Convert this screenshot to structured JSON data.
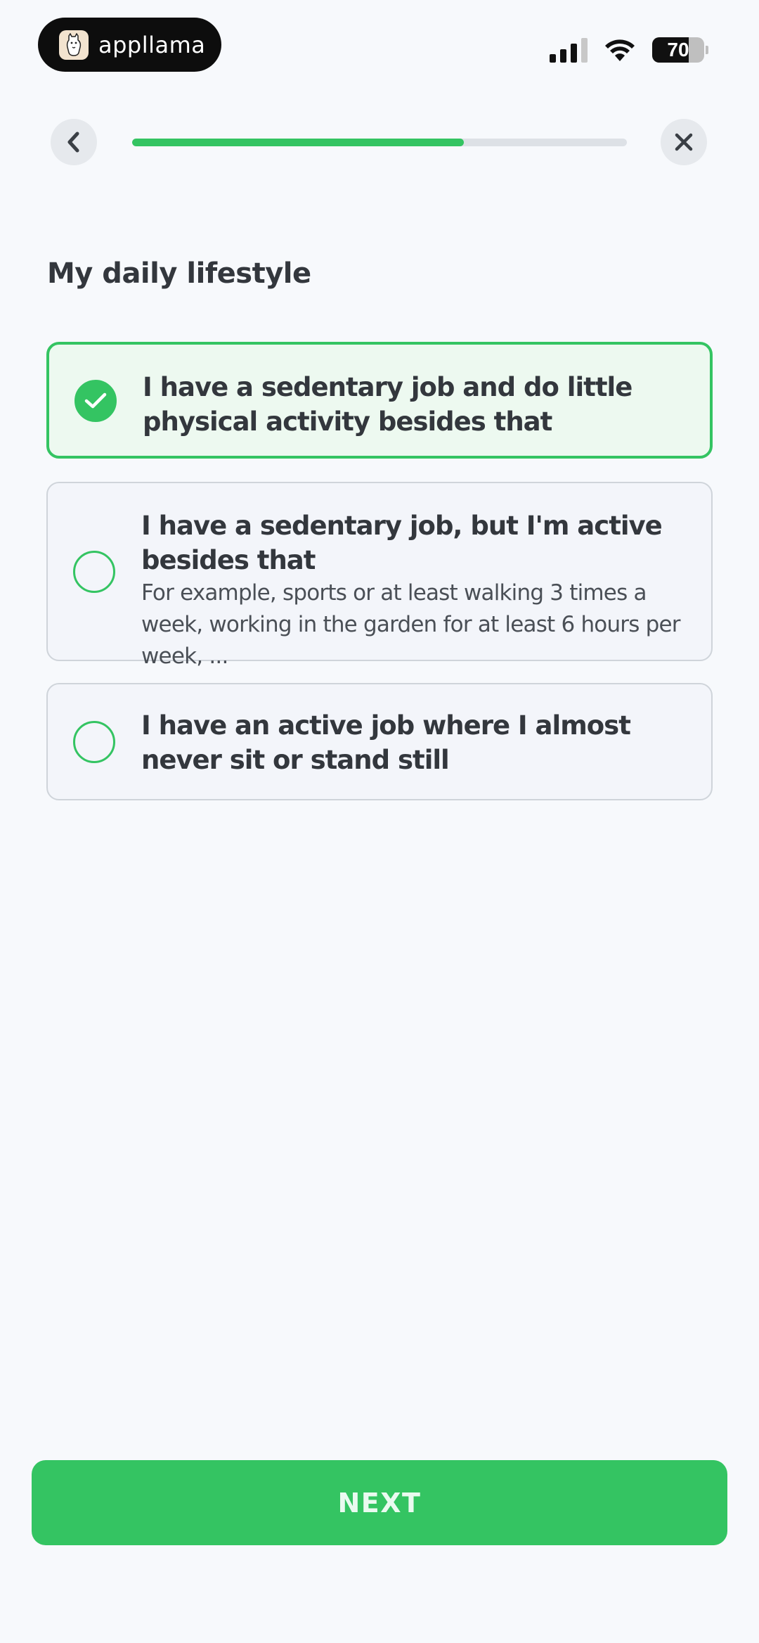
{
  "status_bar": {
    "app_name": "appllama",
    "app_icon": "llama-logo-icon",
    "battery_percent": 70,
    "battery_label": "70",
    "signal_bars_active": 3,
    "signal_bars_total": 4
  },
  "nav": {
    "back_icon": "chevron-left-icon",
    "close_icon": "close-icon",
    "progress": 0.67
  },
  "page": {
    "title": "My daily lifestyle"
  },
  "options": [
    {
      "title": "I have a sedentary job and do little physical activity besides that",
      "subtitle": "",
      "selected": true
    },
    {
      "title": "I have a sedentary job, but I'm active besides that",
      "subtitle": "For example, sports or at least walking 3 times a week, working in the garden for at least 6 hours per week, ...",
      "selected": false
    },
    {
      "title": "I have an active job where I almost never sit or stand still",
      "subtitle": "",
      "selected": false
    }
  ],
  "footer": {
    "next_label": "NEXT"
  },
  "colors": {
    "accent": "#34c462",
    "background": "#f7f9fc",
    "text": "#33373d"
  }
}
